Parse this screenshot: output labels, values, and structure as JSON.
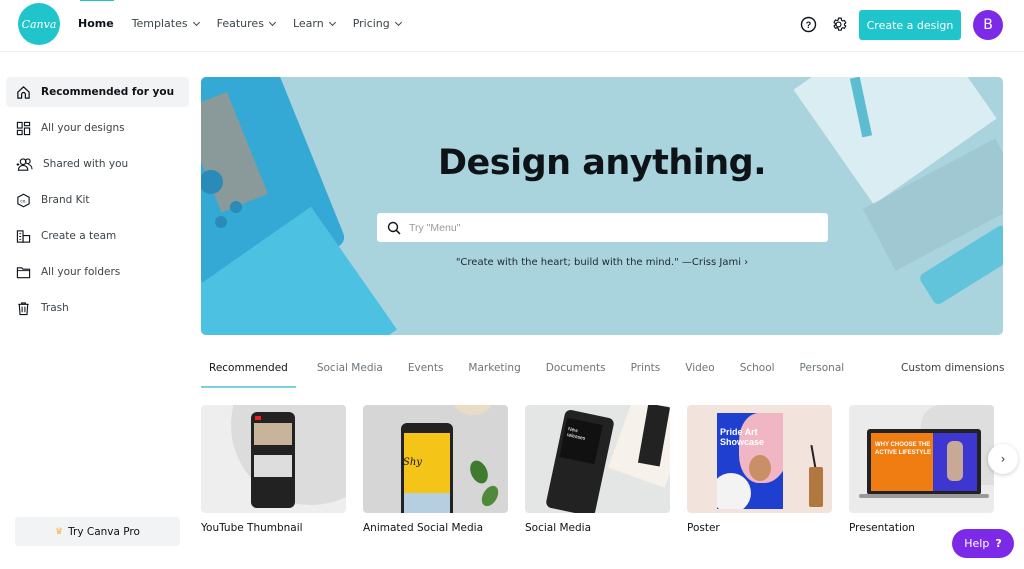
{
  "header": {
    "logo_text": "Canva",
    "nav": [
      {
        "label": "Home",
        "active": true,
        "dropdown": false
      },
      {
        "label": "Templates",
        "dropdown": true
      },
      {
        "label": "Features",
        "dropdown": true
      },
      {
        "label": "Learn",
        "dropdown": true
      },
      {
        "label": "Pricing",
        "dropdown": true
      }
    ],
    "help_icon": "question-circle-icon",
    "settings_icon": "gear-icon",
    "create_label": "Create a design",
    "avatar_initial": "B",
    "accent_color": "#20c4cb",
    "avatar_color": "#7d2ae8"
  },
  "sidebar": {
    "items": [
      {
        "label": "Recommended for you",
        "icon": "home-icon",
        "active": true
      },
      {
        "label": "All your designs",
        "icon": "grid-icon"
      },
      {
        "label": "Shared with you",
        "icon": "people-icon"
      },
      {
        "label": "Brand Kit",
        "icon": "brand-kit-icon"
      },
      {
        "label": "Create a team",
        "icon": "team-icon"
      },
      {
        "label": "All your folders",
        "icon": "folder-icon"
      },
      {
        "label": "Trash",
        "icon": "trash-icon"
      }
    ],
    "pro_label": "Try Canva Pro",
    "pro_icon": "crown-icon"
  },
  "hero": {
    "title": "Design anything.",
    "search_placeholder": "Try \"Menu\"",
    "search_value": "",
    "quote": "\"Create with the heart; build with the mind.\" —Criss Jami ›"
  },
  "tabs": {
    "items": [
      "Recommended",
      "Social Media",
      "Events",
      "Marketing",
      "Documents",
      "Prints",
      "Video",
      "School",
      "Personal"
    ],
    "active_index": 0,
    "custom_label": "Custom dimensions"
  },
  "cards": [
    {
      "label": "YouTube Thumbnail"
    },
    {
      "label": "Animated Social Media",
      "thumb_text": "Shy"
    },
    {
      "label": "Social Media",
      "thumb_text": "New releases"
    },
    {
      "label": "Poster",
      "thumb_text": "Pride Art Showcase"
    },
    {
      "label": "Presentation",
      "thumb_text": "WHY CHOOSE THE ACTIVE LIFESTYLE"
    }
  ],
  "next_label": "›",
  "help": {
    "label": "Help",
    "icon_glyph": "?"
  }
}
